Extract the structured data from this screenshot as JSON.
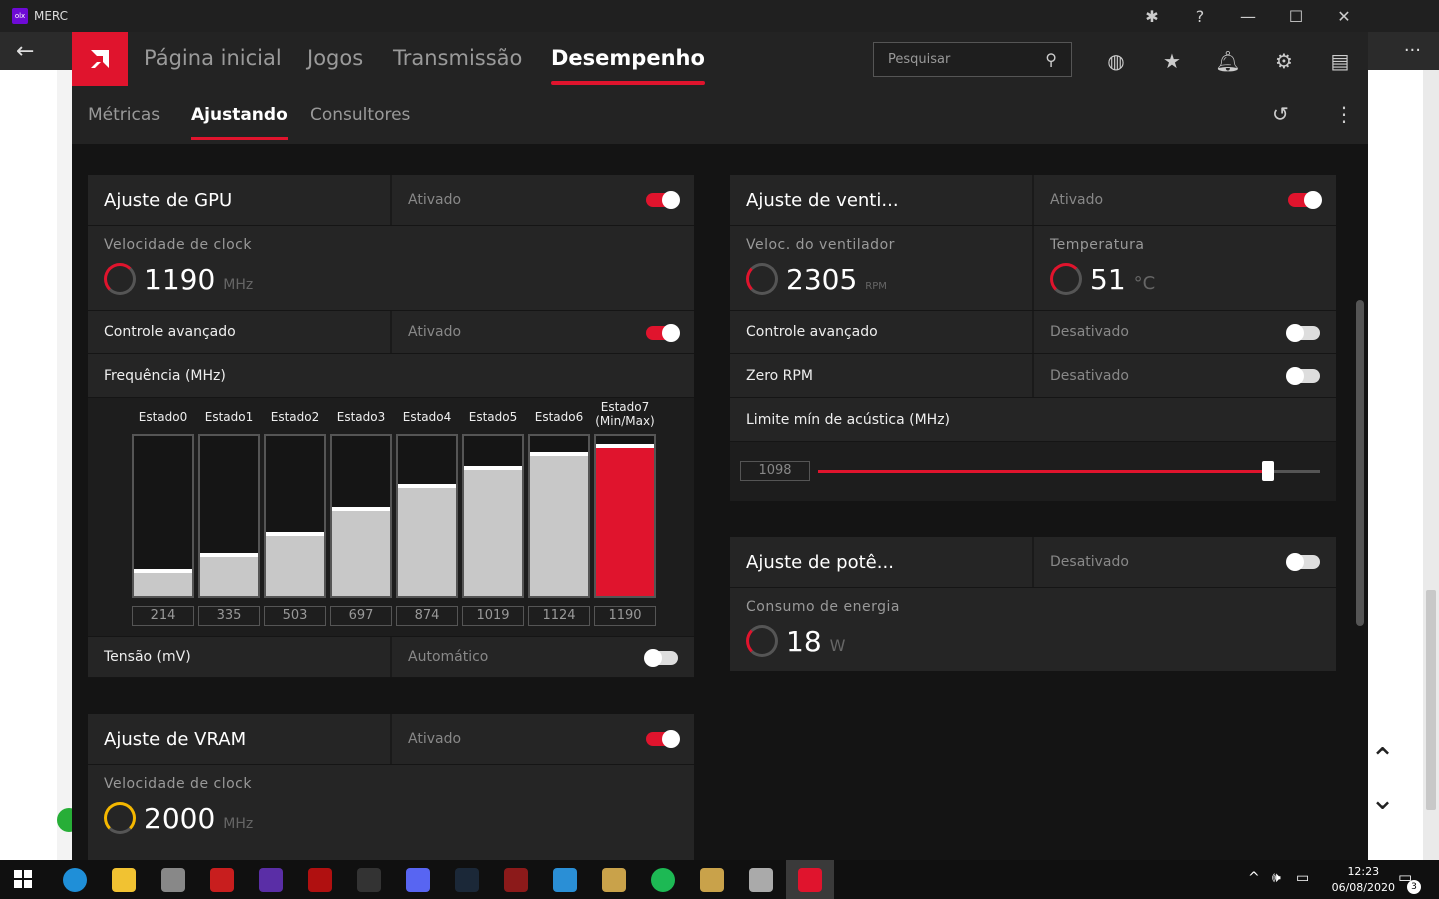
{
  "browser": {
    "tab_title": "MERC",
    "favicon_text": "olx"
  },
  "amd": {
    "nav": {
      "items": [
        "Página inicial",
        "Jogos",
        "Transmissão",
        "Desempenho"
      ],
      "active": "Desempenho"
    },
    "search_placeholder": "Pesquisar",
    "subnav": {
      "items": [
        "Métricas",
        "Ajustando",
        "Consultores"
      ],
      "active": "Ajustando"
    },
    "gpu": {
      "title": "Ajuste de GPU",
      "status": "Ativado",
      "enabled": true,
      "clock_label": "Velocidade de clock",
      "clock_value": "1190",
      "clock_unit": "MHz",
      "advanced_label": "Controle avançado",
      "advanced_status": "Ativado",
      "advanced_enabled": true,
      "freq_label": "Frequência (MHz)",
      "states": [
        "Estado0",
        "Estado1",
        "Estado2",
        "Estado3",
        "Estado4",
        "Estado5",
        "Estado6",
        "Estado7"
      ],
      "state7_sub": "(Min/Max)",
      "values": [
        "214",
        "335",
        "503",
        "697",
        "874",
        "1019",
        "1124",
        "1190"
      ],
      "voltage_label": "Tensão (mV)",
      "voltage_status": "Automático",
      "voltage_enabled": false
    },
    "fan": {
      "title": "Ajuste de venti...",
      "status": "Ativado",
      "enabled": true,
      "speed_label": "Veloc. do ventilador",
      "speed_value": "2305",
      "speed_unit": "RPM",
      "temp_label": "Temperatura",
      "temp_value": "51",
      "temp_unit": "°C",
      "advanced_label": "Controle avançado",
      "advanced_status": "Desativado",
      "zero_label": "Zero RPM",
      "zero_status": "Desativado",
      "acoustic_label": "Limite mín de acústica (MHz)",
      "acoustic_value": "1098"
    },
    "power": {
      "title": "Ajuste de potê...",
      "status": "Desativado",
      "consumption_label": "Consumo de energia",
      "consumption_value": "18",
      "consumption_unit": "W"
    },
    "vram": {
      "title": "Ajuste de VRAM",
      "status": "Ativado",
      "clock_label": "Velocidade de clock",
      "clock_value": "2000",
      "clock_unit": "MHz"
    }
  },
  "tray": {
    "time": "12:23",
    "date": "06/08/2020",
    "notif_count": "3"
  }
}
